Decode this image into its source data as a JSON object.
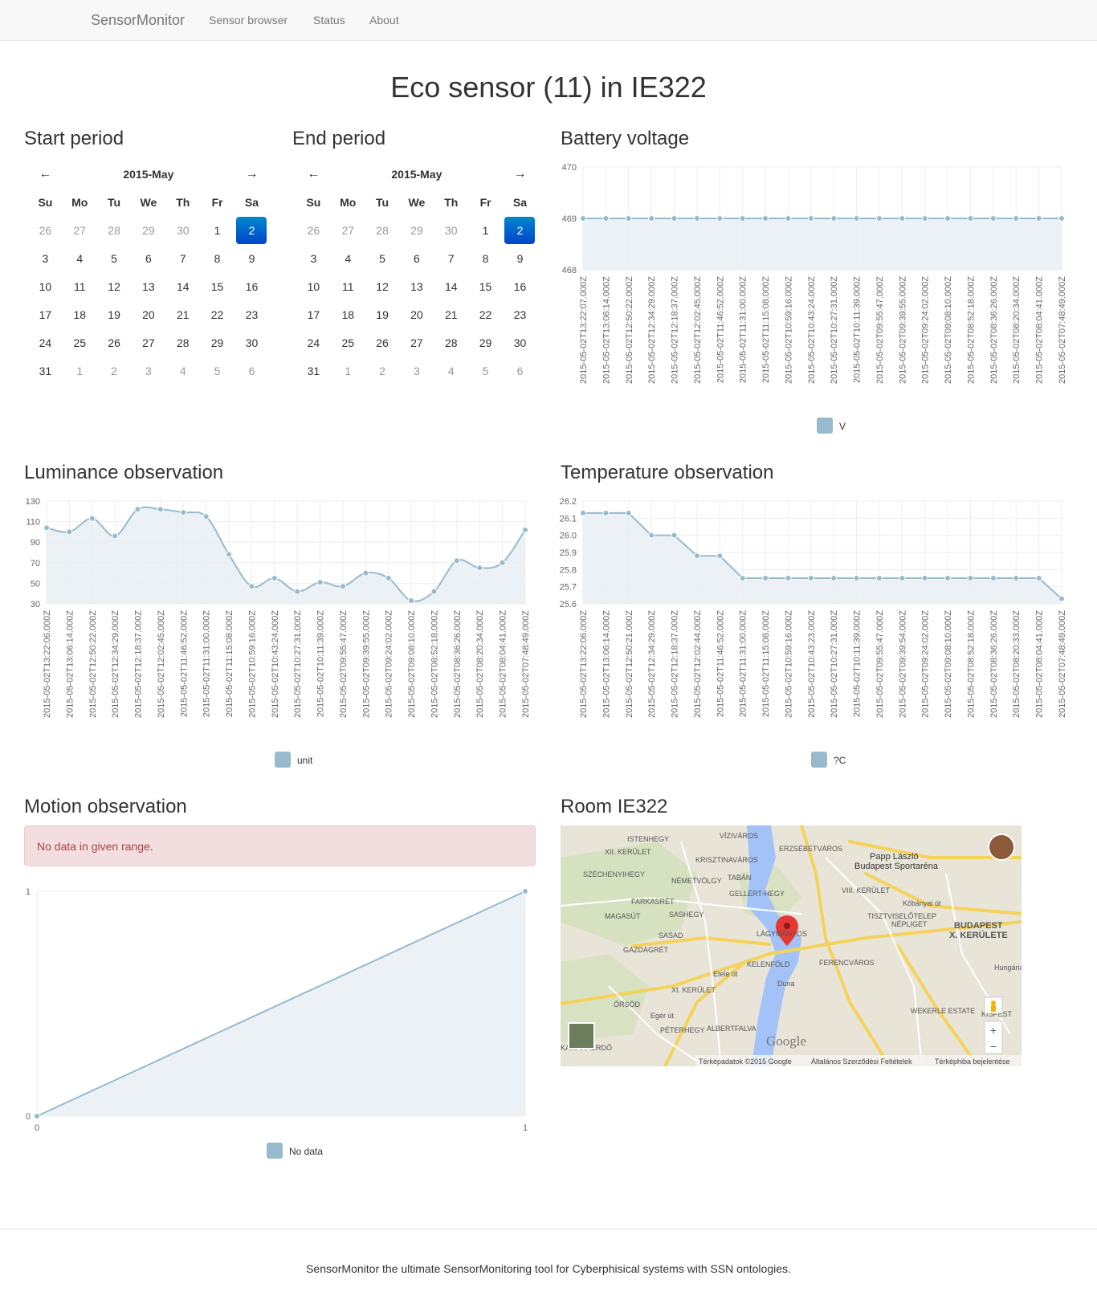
{
  "navbar": {
    "brand": "SensorMonitor",
    "links": [
      "Sensor browser",
      "Status",
      "About"
    ]
  },
  "page_title": "Eco sensor (11) in IE322",
  "start_period": {
    "title": "Start period",
    "month_label": "2015-May",
    "weekdays": [
      "Su",
      "Mo",
      "Tu",
      "We",
      "Th",
      "Fr",
      "Sa"
    ],
    "days": [
      [
        "26",
        "27",
        "28",
        "29",
        "30",
        "1",
        "2"
      ],
      [
        "3",
        "4",
        "5",
        "6",
        "7",
        "8",
        "9"
      ],
      [
        "10",
        "11",
        "12",
        "13",
        "14",
        "15",
        "16"
      ],
      [
        "17",
        "18",
        "19",
        "20",
        "21",
        "22",
        "23"
      ],
      [
        "24",
        "25",
        "26",
        "27",
        "28",
        "29",
        "30"
      ],
      [
        "31",
        "1",
        "2",
        "3",
        "4",
        "5",
        "6"
      ]
    ],
    "selected": "2"
  },
  "end_period": {
    "title": "End period",
    "month_label": "2015-May",
    "weekdays": [
      "Su",
      "Mo",
      "Tu",
      "We",
      "Th",
      "Fr",
      "Sa"
    ],
    "days": [
      [
        "26",
        "27",
        "28",
        "29",
        "30",
        "1",
        "2"
      ],
      [
        "3",
        "4",
        "5",
        "6",
        "7",
        "8",
        "9"
      ],
      [
        "10",
        "11",
        "12",
        "13",
        "14",
        "15",
        "16"
      ],
      [
        "17",
        "18",
        "19",
        "20",
        "21",
        "22",
        "23"
      ],
      [
        "24",
        "25",
        "26",
        "27",
        "28",
        "29",
        "30"
      ],
      [
        "31",
        "1",
        "2",
        "3",
        "4",
        "5",
        "6"
      ]
    ],
    "selected": "2"
  },
  "sections": {
    "battery": "Battery voltage",
    "luminance": "Luminance observation",
    "temperature": "Temperature observation",
    "motion": "Motion observation",
    "room": "Room IE322"
  },
  "motion_alert": "No data in given range.",
  "map": {
    "labels": [
      "ISTENHEGY",
      "VÍZIVÁROS",
      "ERZSÉBETVÁROS",
      "XII. KERÜLET",
      "KRISZTINAVÁROS",
      "Papp László",
      "Budapest Sportaréna",
      "SZÉCHENYIHEGY",
      "NÉMETVÖLGY",
      "TABÁN",
      "GELLÉRT-HEGY",
      "VIII. KERÜLET",
      "FARKASRÉT",
      "MAGASÚT",
      "SASHEGY",
      "TISZTVISELŐTELEP",
      "NÉPLIGET",
      "BUDAPEST",
      "X. KERÜLETE",
      "SASAD",
      "LÁGYMÁNYOS",
      "GAZDAGRÉT",
      "KELENFÖLD",
      "FERENCVÁROS",
      "XI. KERÜLET",
      "ŐRSÖD",
      "WEKERLE ESTATE",
      "KISPEST",
      "PÉTERHEGY",
      "ALBERTFALVA",
      "KAMARAERDŐ",
      "Duna",
      "Kőbányai út",
      "Egér út",
      "Etele út",
      "Hungária"
    ],
    "footer": [
      "Térképadatok ©2015 Google",
      "Általános Szerződési Feltételek",
      "Térképhiba bejelentése"
    ],
    "logo": "Google",
    "zoom_in": "+",
    "zoom_out": "−"
  },
  "footer_text": "SensorMonitor the ultimate SensorMonitoring tool for Cyberphisical systems with SSN ontologies.",
  "colors": {
    "series": "#97bbcd",
    "fill": "#e8eef2",
    "grid": "#eeeeee",
    "active": "#0066cc"
  },
  "chart_data": [
    {
      "id": "battery",
      "type": "line",
      "x": [
        "2015-05-02T13:22:07.000Z",
        "2015-05-02T13:06:14.000Z",
        "2015-05-02T12:50:22.000Z",
        "2015-05-02T12:34:29.000Z",
        "2015-05-02T12:18:37.000Z",
        "2015-05-02T12:02:45.000Z",
        "2015-05-02T11:46:52.000Z",
        "2015-05-02T11:31:00.000Z",
        "2015-05-02T11:15:08.000Z",
        "2015-05-02T10:59:16.000Z",
        "2015-05-02T10:43:24.000Z",
        "2015-05-02T10:27:31.000Z",
        "2015-05-02T10:11:39.000Z",
        "2015-05-02T09:55:47.000Z",
        "2015-05-02T09:39:55.000Z",
        "2015-05-02T09:24:02.000Z",
        "2015-05-02T09:08:10.000Z",
        "2015-05-02T08:52:18.000Z",
        "2015-05-02T08:36:26.000Z",
        "2015-05-02T08:20:34.000Z",
        "2015-05-02T08:04:41.000Z",
        "2015-05-02T07:48:49.000Z"
      ],
      "series": [
        {
          "name": "V",
          "values": [
            469,
            469,
            469,
            469,
            469,
            469,
            469,
            469,
            469,
            469,
            469,
            469,
            469,
            469,
            469,
            469,
            469,
            469,
            469,
            469,
            469,
            469
          ]
        }
      ],
      "yticks": [
        "468",
        "469",
        "470"
      ],
      "ylim": [
        468,
        470
      ]
    },
    {
      "id": "luminance",
      "type": "line",
      "x": [
        "2015-05-02T13:22:06.000Z",
        "2015-05-02T13:06:14.000Z",
        "2015-05-02T12:50:22.000Z",
        "2015-05-02T12:34:29.000Z",
        "2015-05-02T12:18:37.000Z",
        "2015-05-02T12:02:45.000Z",
        "2015-05-02T11:46:52.000Z",
        "2015-05-02T11:31:00.000Z",
        "2015-05-02T11:15:08.000Z",
        "2015-05-02T10:59:16.000Z",
        "2015-05-02T10:43:24.000Z",
        "2015-05-02T10:27:31.000Z",
        "2015-05-02T10:11:39.000Z",
        "2015-05-02T09:55:47.000Z",
        "2015-05-02T09:39:55.000Z",
        "2015-05-02T09:24:02.000Z",
        "2015-05-02T09:08:10.000Z",
        "2015-05-02T08:52:18.000Z",
        "2015-05-02T08:36:26.000Z",
        "2015-05-02T08:20:34.000Z",
        "2015-05-02T08:04:41.000Z",
        "2015-05-02T07:48:49.000Z"
      ],
      "series": [
        {
          "name": "unit",
          "values": [
            104,
            100,
            113,
            96,
            122,
            122,
            119,
            115,
            78,
            47,
            55,
            42,
            51,
            47,
            60,
            55,
            33,
            42,
            72,
            65,
            70,
            102
          ]
        }
      ],
      "yticks": [
        "30",
        "50",
        "70",
        "90",
        "110",
        "130"
      ],
      "ylim": [
        30,
        130
      ]
    },
    {
      "id": "temperature",
      "type": "line",
      "x": [
        "2015-05-02T13:22:06.000Z",
        "2015-05-02T13:06:14.000Z",
        "2015-05-02T12:50:21.000Z",
        "2015-05-02T12:34:29.000Z",
        "2015-05-02T12:18:37.000Z",
        "2015-05-02T12:02:44.000Z",
        "2015-05-02T11:46:52.000Z",
        "2015-05-02T11:31:00.000Z",
        "2015-05-02T11:15:08.000Z",
        "2015-05-02T10:59:16.000Z",
        "2015-05-02T10:43:23.000Z",
        "2015-05-02T10:27:31.000Z",
        "2015-05-02T10:11:39.000Z",
        "2015-05-02T09:55:47.000Z",
        "2015-05-02T09:39:54.000Z",
        "2015-05-02T09:24:02.000Z",
        "2015-05-02T09:08:10.000Z",
        "2015-05-02T08:52:18.000Z",
        "2015-05-02T08:36:26.000Z",
        "2015-05-02T08:20:33.000Z",
        "2015-05-02T08:04:41.000Z",
        "2015-05-02T07:48:49.000Z"
      ],
      "series": [
        {
          "name": "?C",
          "values": [
            26.13,
            26.13,
            26.13,
            26.0,
            26.0,
            25.88,
            25.88,
            25.75,
            25.75,
            25.75,
            25.75,
            25.75,
            25.75,
            25.75,
            25.75,
            25.75,
            25.75,
            25.75,
            25.75,
            25.75,
            25.75,
            25.63
          ]
        }
      ],
      "yticks": [
        "25.6",
        "25.7",
        "25.8",
        "25.9",
        "26.0",
        "26.1",
        "26.2"
      ],
      "ylim": [
        25.6,
        26.2
      ]
    },
    {
      "id": "motion",
      "type": "line",
      "x": [
        "0",
        "1"
      ],
      "series": [
        {
          "name": "No data",
          "values": [
            0,
            1
          ]
        }
      ],
      "yticks": [
        "0",
        "1"
      ],
      "ylim": [
        0,
        1
      ]
    }
  ]
}
